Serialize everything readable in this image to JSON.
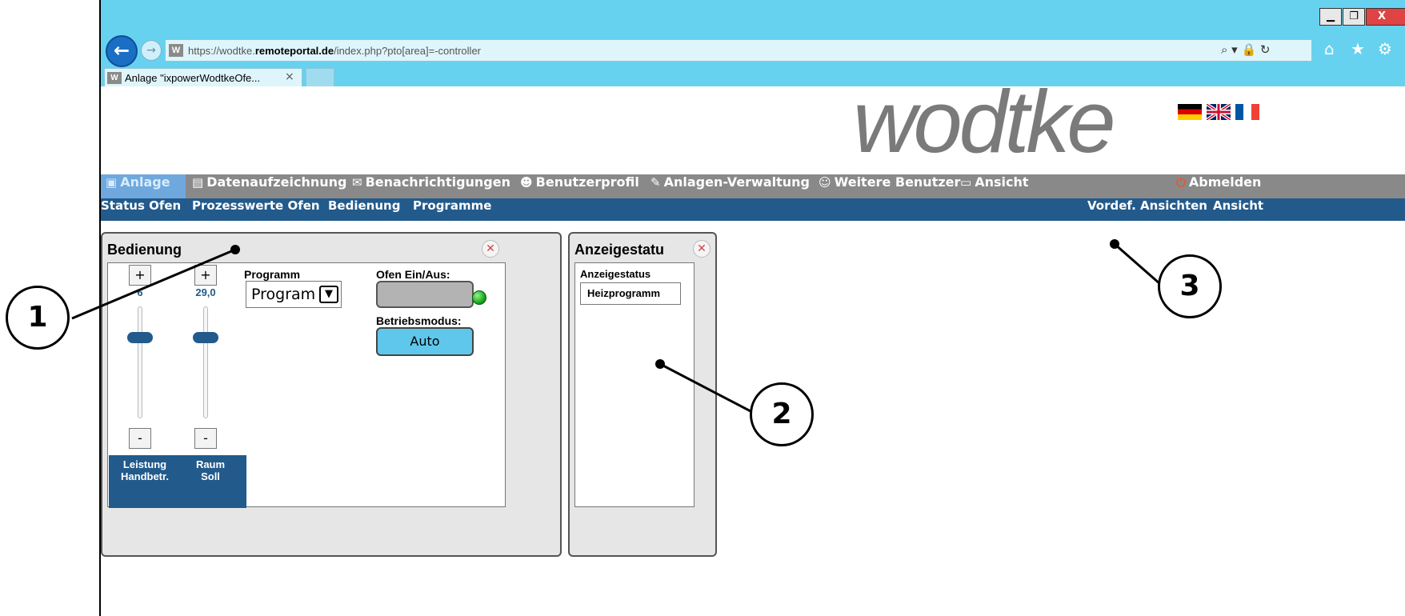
{
  "browser": {
    "url_prefix": "https://wodtke.",
    "url_domain": "remoteportal.de",
    "url_path": "/index.php?pto[area]=-controller",
    "tab_title": "Anlage \"ixpowerWodtkeOfe...",
    "tab_close": "×",
    "site_icon": "W",
    "window_min": "▁",
    "window_max": "❐",
    "window_close": "X",
    "addr_tools": "⌕ ▾ 🔒 ↻",
    "icons": [
      "back-icon",
      "forward-icon",
      "home-icon",
      "star-icon",
      "gear-icon"
    ]
  },
  "header": {
    "logo": "wodtke",
    "flags": [
      "de",
      "gb",
      "fr"
    ]
  },
  "main_nav": [
    {
      "label": "Anlage",
      "icon": "▣"
    },
    {
      "label": "Datenaufzeichnung",
      "icon": "▤"
    },
    {
      "label": "Benachrichtigungen",
      "icon": "✉"
    },
    {
      "label": "Benutzerprofil",
      "icon": "☻"
    },
    {
      "label": "Anlagen-Verwaltung",
      "icon": "✎"
    },
    {
      "label": "Weitere Benutzer",
      "icon": "☺"
    },
    {
      "label": "Ansicht",
      "icon": "▭"
    },
    {
      "label": "Abmelden",
      "icon": "⏻"
    }
  ],
  "sub_nav": {
    "left": [
      "Status Ofen",
      "Prozesswerte Ofen",
      "Bedienung",
      "Programme"
    ],
    "right": [
      "Vordef. Ansichten",
      "Ansicht"
    ]
  },
  "panel_bedienung": {
    "title": "Bedienung",
    "close": "✕",
    "sliders": [
      {
        "plus": "+",
        "minus": "-",
        "value": "6",
        "label_line1": "Leistung",
        "label_line2": "Handbetr."
      },
      {
        "plus": "+",
        "minus": "-",
        "value": "29,0",
        "label_line1": "Raum",
        "label_line2": "Soll"
      }
    ],
    "program_label": "Programm",
    "program_value": "Program",
    "program_arrow": "❯",
    "ofen_label": "Ofen Ein/Aus:",
    "mode_label": "Betriebsmodus:",
    "mode_value": "Auto"
  },
  "panel_anzeige": {
    "title": "Anzeigestatu",
    "close": "✕",
    "field_label": "Anzeigestatus",
    "field_value": "Heizprogramm"
  },
  "callouts": [
    "1",
    "2",
    "3"
  ]
}
